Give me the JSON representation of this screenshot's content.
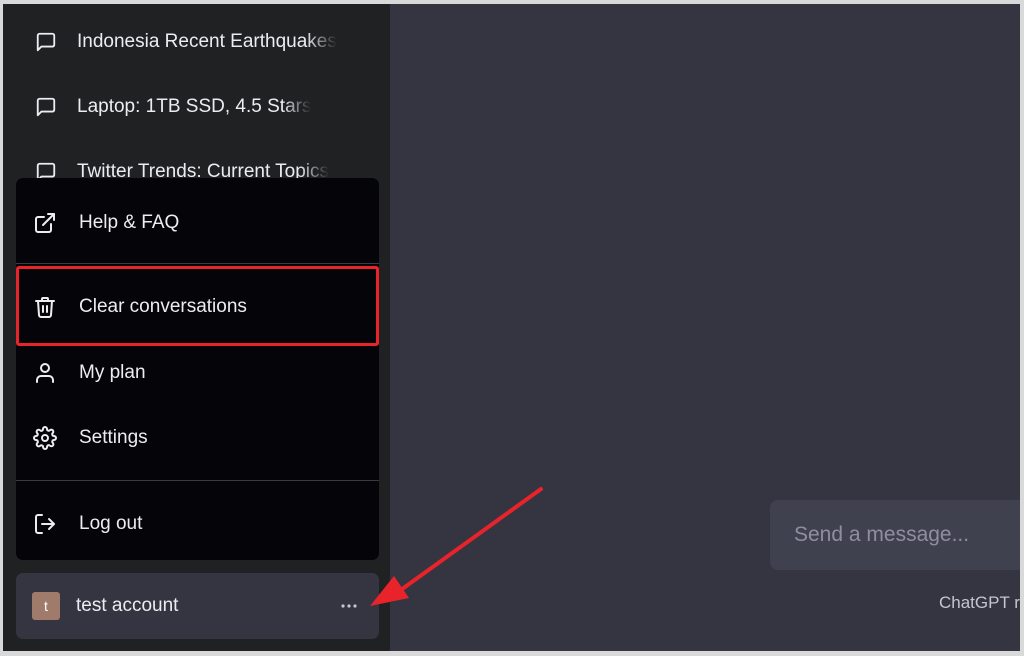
{
  "sidebar": {
    "conversations": [
      {
        "label": "Indonesia Recent Earthquakes",
        "icon": "chat-bubble-icon"
      },
      {
        "label": "Laptop: 1TB SSD, 4.5 Stars",
        "icon": "chat-bubble-icon"
      },
      {
        "label": "Twitter Trends: Current Topics",
        "icon": "chat-bubble-icon"
      }
    ]
  },
  "menu": {
    "help_label": "Help & FAQ",
    "clear_label": "Clear conversations",
    "plan_label": "My plan",
    "settings_label": "Settings",
    "logout_label": "Log out"
  },
  "account": {
    "avatar_initial": "t",
    "name": "test account"
  },
  "composer": {
    "placeholder": "Send a message..."
  },
  "footer": {
    "note": "ChatGPT r"
  },
  "colors": {
    "sidebar_bg": "#202123",
    "menu_bg": "#050509",
    "main_bg": "#343541",
    "highlight": "#e8232a",
    "annotation_arrow": "#e8232a"
  }
}
